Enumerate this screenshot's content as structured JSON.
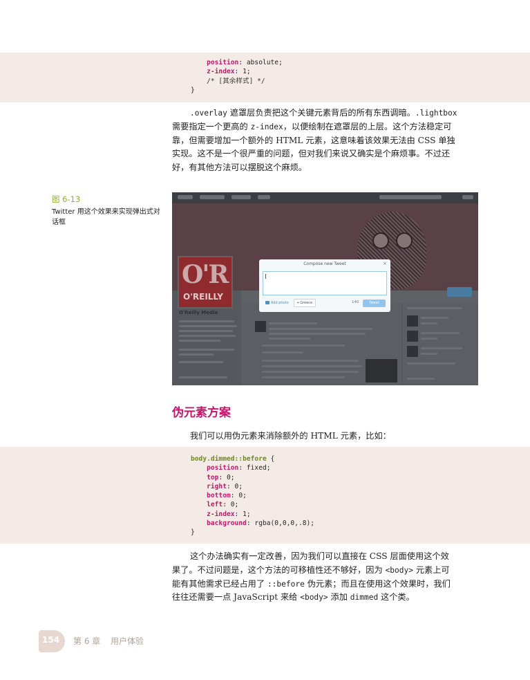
{
  "code_top": {
    "lines": [
      {
        "prop": "position",
        "value": "absolute;"
      },
      {
        "prop": "z-index",
        "value": "1;"
      },
      {
        "comment": "/* [其余样式] */"
      },
      {
        "close": "}"
      }
    ]
  },
  "para1": {
    "lines": [
      [
        {
          "mono": ".overlay"
        },
        {
          "t": " 遮罩层负责把这个关键元素背后的所有东西调暗。"
        },
        {
          "mono": ".lightbox"
        }
      ],
      [
        {
          "t": "需要指定一个更高的 "
        },
        {
          "mono": "z-index"
        },
        {
          "t": "，以便绘制在遮罩层的上层。这个方法稳定可"
        }
      ],
      [
        {
          "t": "靠，但需要增加一个额外的 HTML 元素，这意味着该效果无法由 CSS 单独"
        }
      ],
      [
        {
          "t": "实现。这不是一个很严重的问题，但对我们来说又确实是个麻烦事。不过还"
        }
      ],
      [
        {
          "t": "好，有其他方法可以摆脱这个麻烦。"
        }
      ]
    ]
  },
  "figure": {
    "label": "图 6-13",
    "caption": "Twitter 用这个效果来实现弹出式对话框",
    "screenshot": {
      "logo_text": "O'R",
      "logo_sub": "O'REILLY",
      "profile_name": "O'Reilly Media",
      "modal_title": "Compose new Tweet",
      "modal_close": "×",
      "add_photo": "Add photo",
      "location": "Greece",
      "char_count": "140",
      "tweet_button": "Tweet"
    }
  },
  "section": {
    "heading": "伪元素方案"
  },
  "para2": {
    "text": "我们可以用伪元素来消除额外的 HTML 元素，比如："
  },
  "code_main": {
    "selector": "body.dimmed::before",
    "open": " {",
    "lines": [
      {
        "prop": "position",
        "value": "fixed;"
      },
      {
        "prop": "top",
        "value": "0;"
      },
      {
        "prop": "right",
        "value": "0;"
      },
      {
        "prop": "bottom",
        "value": "0;"
      },
      {
        "prop": "left",
        "value": "0;"
      },
      {
        "prop": "z-index",
        "value": "1;"
      },
      {
        "prop": "background",
        "value": "rgba(0,0,0,.8);"
      }
    ],
    "close": "}"
  },
  "para3": {
    "lines": [
      [
        {
          "t": "这个办法确实有一定改善，因为我们可以直接在 CSS 层面使用这个效"
        }
      ],
      [
        {
          "t": "果了。不过问题是，这个方法的可移植性还不够好，因为 "
        },
        {
          "mono": "<body>"
        },
        {
          "t": " 元素上可"
        }
      ],
      [
        {
          "t": "能有其他需求已经占用了 "
        },
        {
          "mono": "::before"
        },
        {
          "t": " 伪元素；而且在使用这个效果时，我们"
        }
      ],
      [
        {
          "t": "往往还需要一点 JavaScript 来给 "
        },
        {
          "mono": "<body>"
        },
        {
          "t": " 添加 "
        },
        {
          "mono": "dimmed"
        },
        {
          "t": " 这个类。"
        }
      ]
    ]
  },
  "footer": {
    "page_number": "154",
    "chapter": "第 6 章",
    "title": "用户体验"
  },
  "colors": {
    "accent_magenta": "#c2186e",
    "accent_green": "#8db32a",
    "code_bg": "#f4ebe6"
  }
}
